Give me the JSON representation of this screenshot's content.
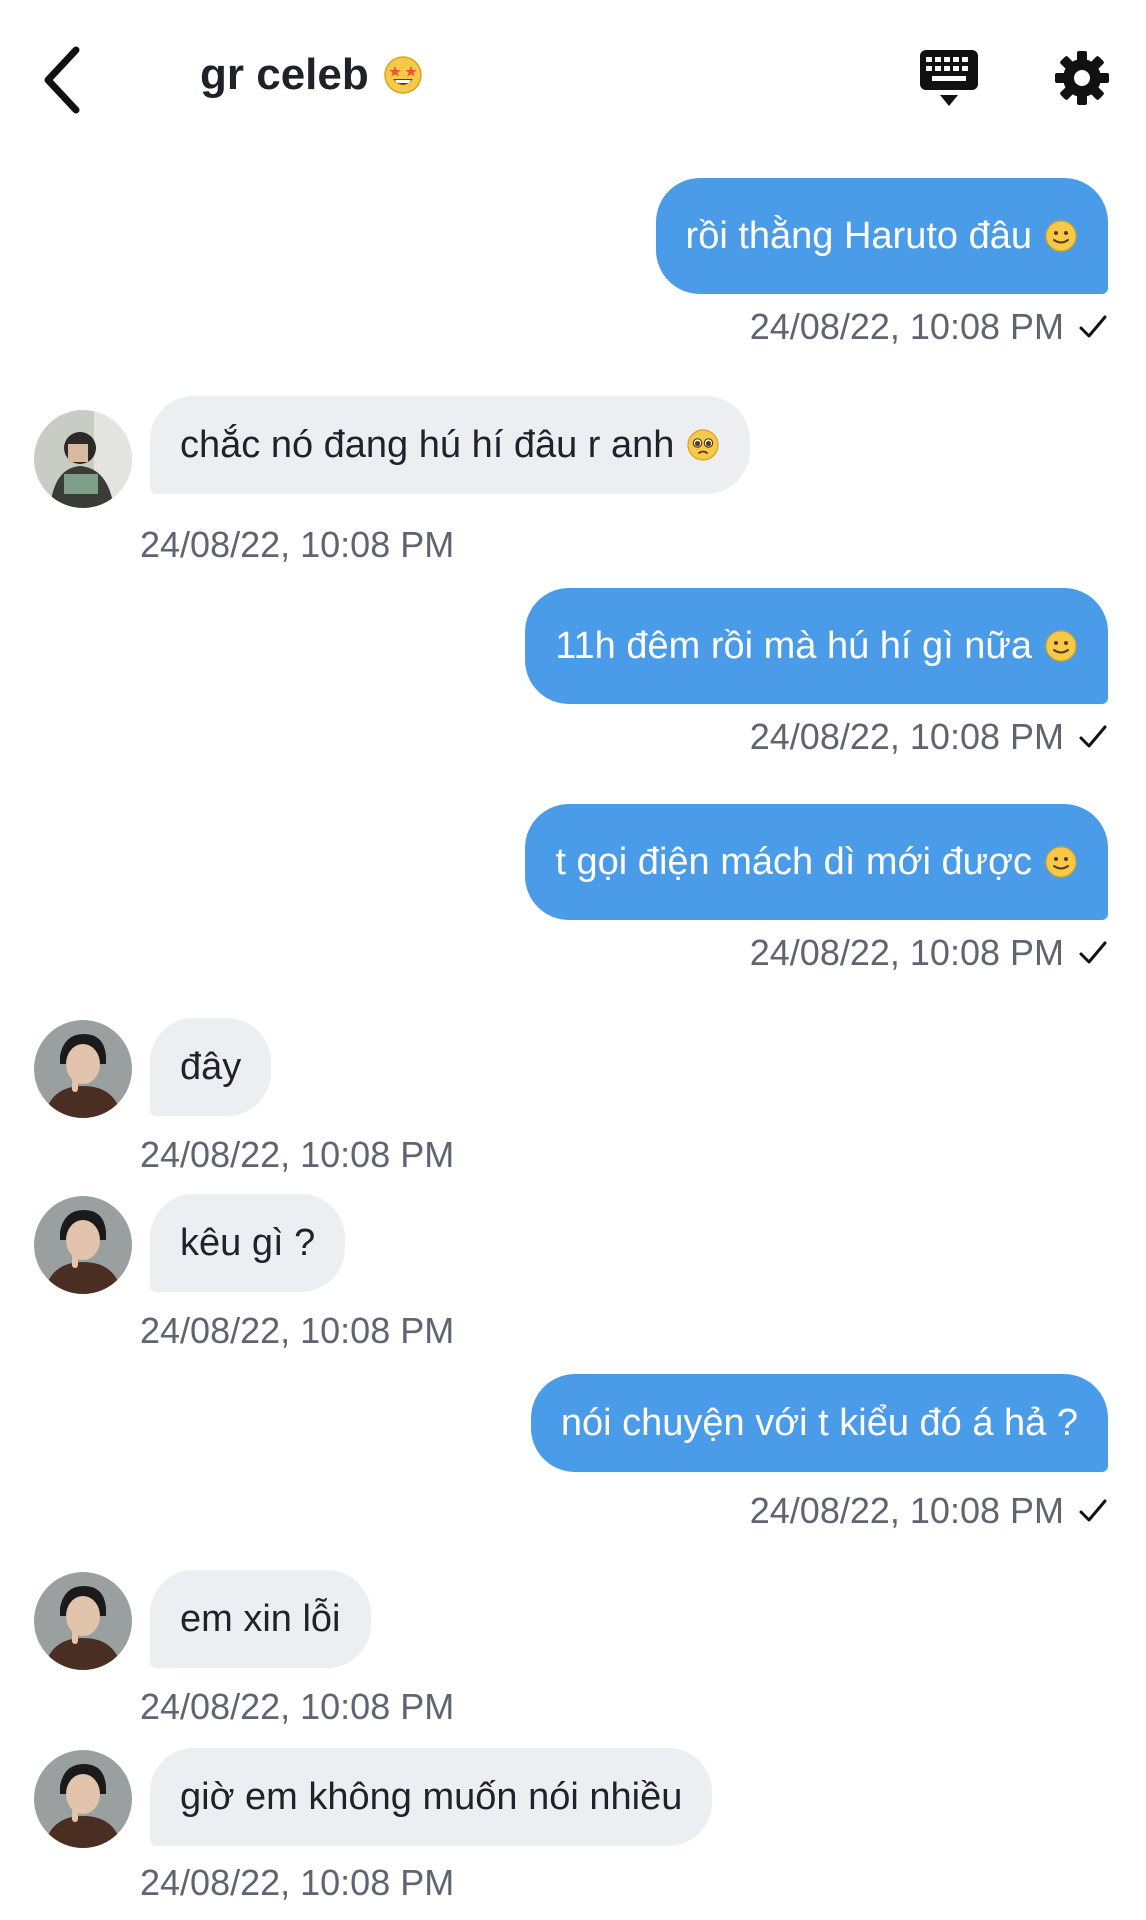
{
  "header": {
    "back_icon": "chevron-left-icon",
    "title": "gr celeb",
    "title_emoji": "star-struck-emoji",
    "keyboard_icon": "keyboard-icon",
    "settings_icon": "gear-icon"
  },
  "colors": {
    "outgoing_bubble": "#4a9be8",
    "incoming_bubble": "#eceef2",
    "timestamp": "#5f6570"
  },
  "messages": [
    {
      "side": "out",
      "text": "rồi thằng Haruto đâu",
      "emoji": "slight-smile",
      "time": "24/08/22, 10:08 PM"
    },
    {
      "side": "in",
      "avatar": "avatar-1",
      "text": "chắc nó đang hú hí đâu r anh",
      "emoji": "pleading-face",
      "time": "24/08/22, 10:08 PM"
    },
    {
      "side": "out",
      "text": "11h đêm rồi mà hú hí gì nữa",
      "emoji": "slight-smile",
      "time": "24/08/22, 10:08 PM"
    },
    {
      "side": "out",
      "text": "t gọi điện mách dì mới được",
      "emoji": "slight-smile",
      "time": "24/08/22, 10:08 PM"
    },
    {
      "side": "in",
      "avatar": "avatar-2",
      "text": "đây",
      "time": "24/08/22, 10:08 PM"
    },
    {
      "side": "in",
      "avatar": "avatar-2",
      "text": "kêu gì ?",
      "time": "24/08/22, 10:08 PM"
    },
    {
      "side": "out",
      "text": "nói chuyện với t kiểu đó á hả ?",
      "time": "24/08/22, 10:08 PM"
    },
    {
      "side": "in",
      "avatar": "avatar-2",
      "text": "em xin lỗi",
      "time": "24/08/22, 10:08 PM"
    },
    {
      "side": "in",
      "avatar": "avatar-2",
      "text": "giờ em không muốn nói nhiều",
      "time": "24/08/22, 10:08 PM"
    }
  ]
}
